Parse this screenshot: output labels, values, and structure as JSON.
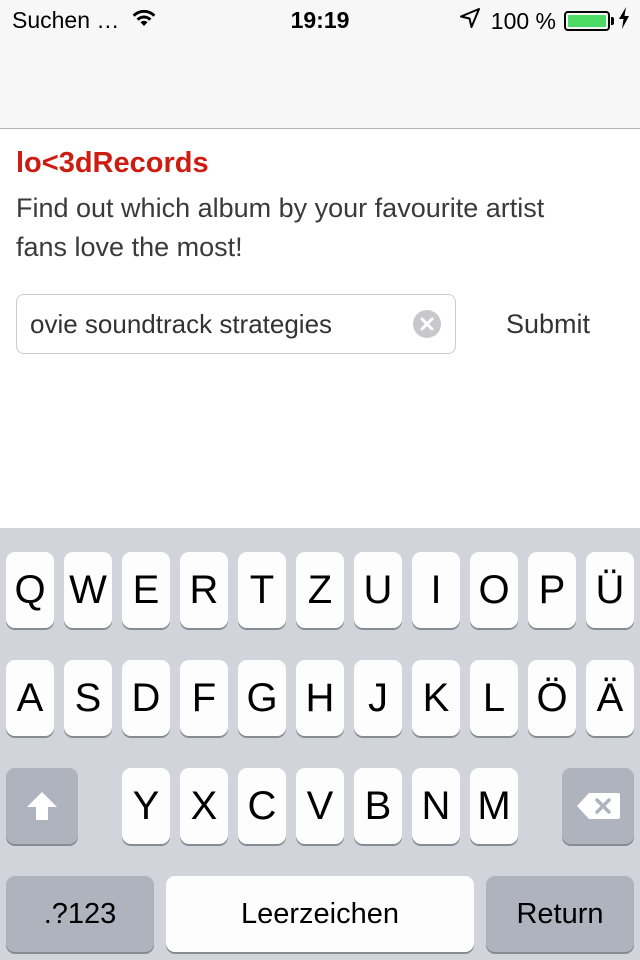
{
  "status_bar": {
    "carrier": "Suchen …",
    "time": "19:19",
    "battery_percent": "100 %",
    "battery_level": 1.0,
    "icons": [
      "wifi-icon",
      "location-arrow-icon",
      "battery-icon",
      "charging-bolt-icon"
    ]
  },
  "app": {
    "title": "lo<3dRecords",
    "description": "Find out which album by your favourite artist fans love the most!",
    "title_color": "#cc1d12"
  },
  "search": {
    "value": "ovie soundtrack strategies",
    "clear_icon": "clear-circle-icon"
  },
  "submit_label": "Submit",
  "keyboard": {
    "row1": [
      "Q",
      "W",
      "E",
      "R",
      "T",
      "Z",
      "U",
      "I",
      "O",
      "P",
      "Ü"
    ],
    "row2": [
      "A",
      "S",
      "D",
      "F",
      "G",
      "H",
      "J",
      "K",
      "L",
      "Ö",
      "Ä"
    ],
    "row3": [
      "Y",
      "X",
      "C",
      "V",
      "B",
      "N",
      "M"
    ],
    "numbers_label": ".?123",
    "space_label": "Leerzeichen",
    "return_label": "Return",
    "shift_icon": "shift-arrow-icon",
    "delete_icon": "backspace-icon"
  }
}
